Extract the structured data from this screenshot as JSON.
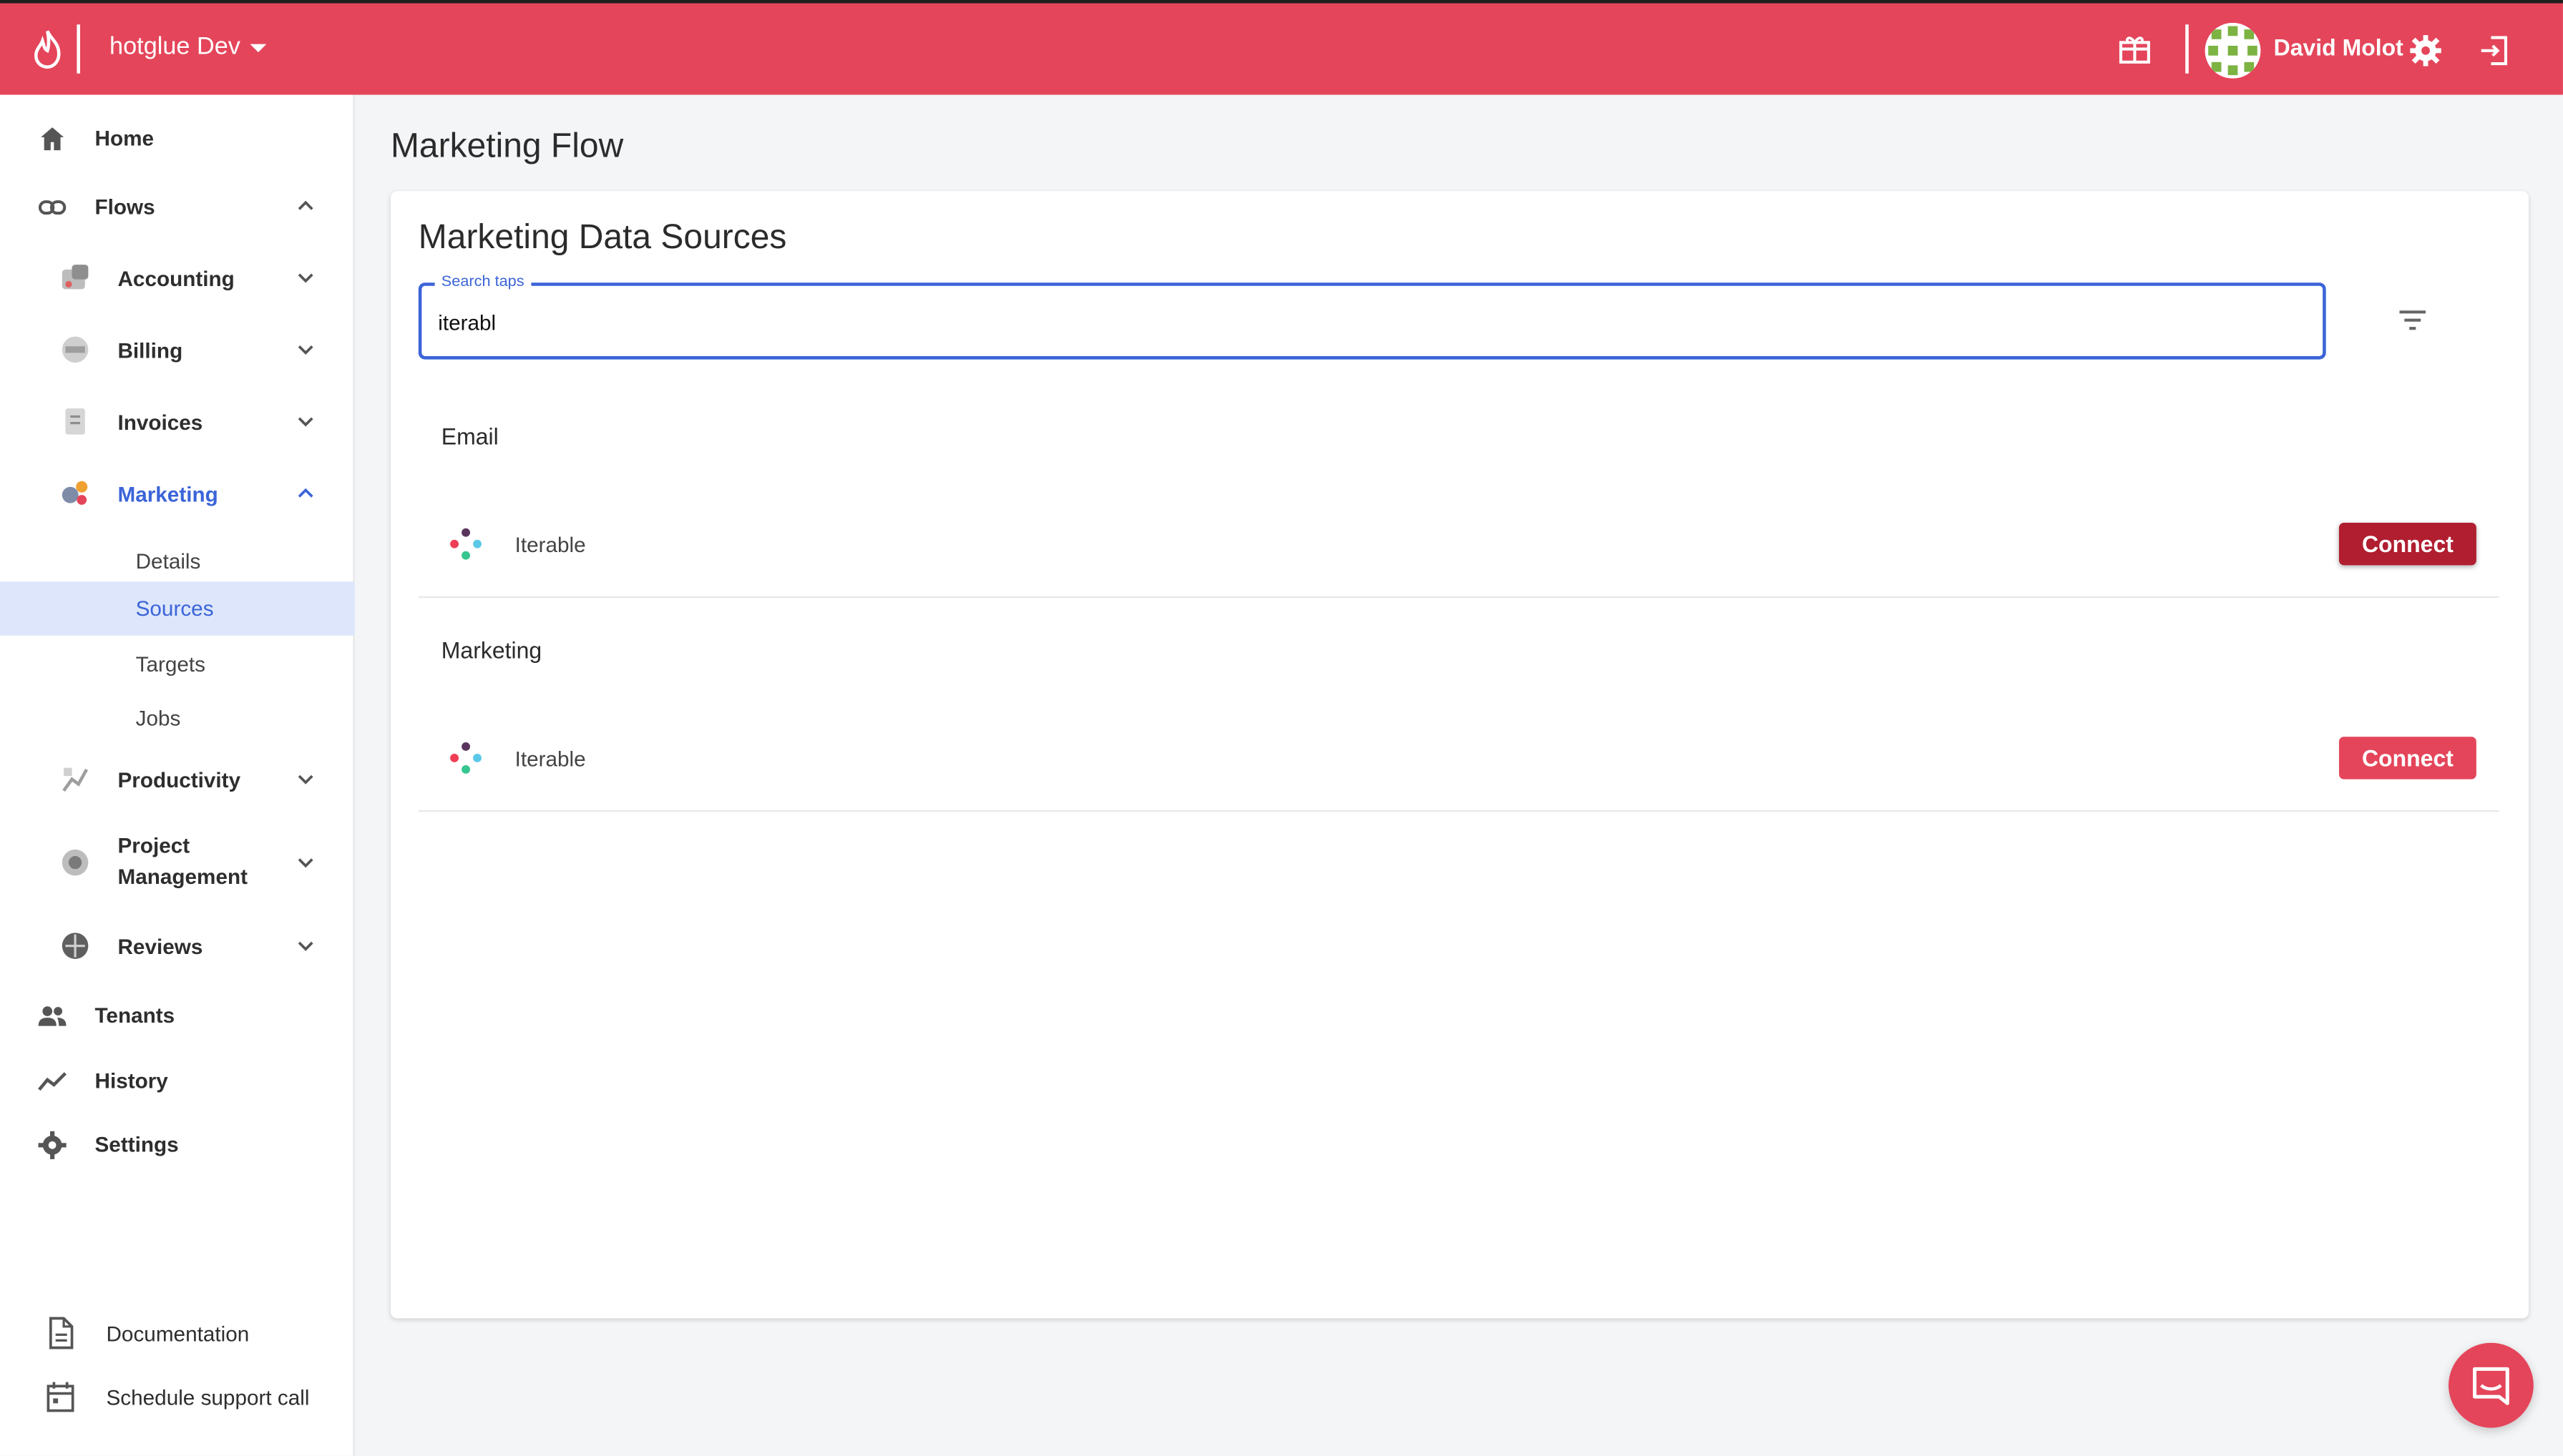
{
  "topbar": {
    "org_name": "hotglue Dev",
    "user_name": "David Molot",
    "brand_color": "#e4455a",
    "icons": [
      "flame-logo-icon",
      "gift-icon",
      "gear-icon",
      "logout-icon"
    ]
  },
  "sidebar": {
    "home": "Home",
    "flows": "Flows",
    "accounting": "Accounting",
    "billing": "Billing",
    "invoices": "Invoices",
    "marketing": "Marketing",
    "details": "Details",
    "sources": "Sources",
    "targets": "Targets",
    "jobs": "Jobs",
    "productivity": "Productivity",
    "project_management_line1": "Project",
    "project_management_line2": "Management",
    "reviews": "Reviews",
    "tenants": "Tenants",
    "history": "History",
    "settings": "Settings",
    "documentation": "Documentation",
    "schedule_support": "Schedule support call",
    "active_color": "#3b64d8"
  },
  "main": {
    "page_title": "Marketing Flow",
    "card_title": "Marketing Data Sources",
    "search": {
      "label": "Search taps",
      "value": "iterabl"
    },
    "sections": [
      {
        "title": "Email",
        "taps": [
          {
            "name": "Iterable",
            "button": "Connect",
            "button_color": "#b01e30"
          }
        ]
      },
      {
        "title": "Marketing",
        "taps": [
          {
            "name": "Iterable",
            "button": "Connect",
            "button_color": "#e4455a"
          }
        ]
      }
    ]
  }
}
